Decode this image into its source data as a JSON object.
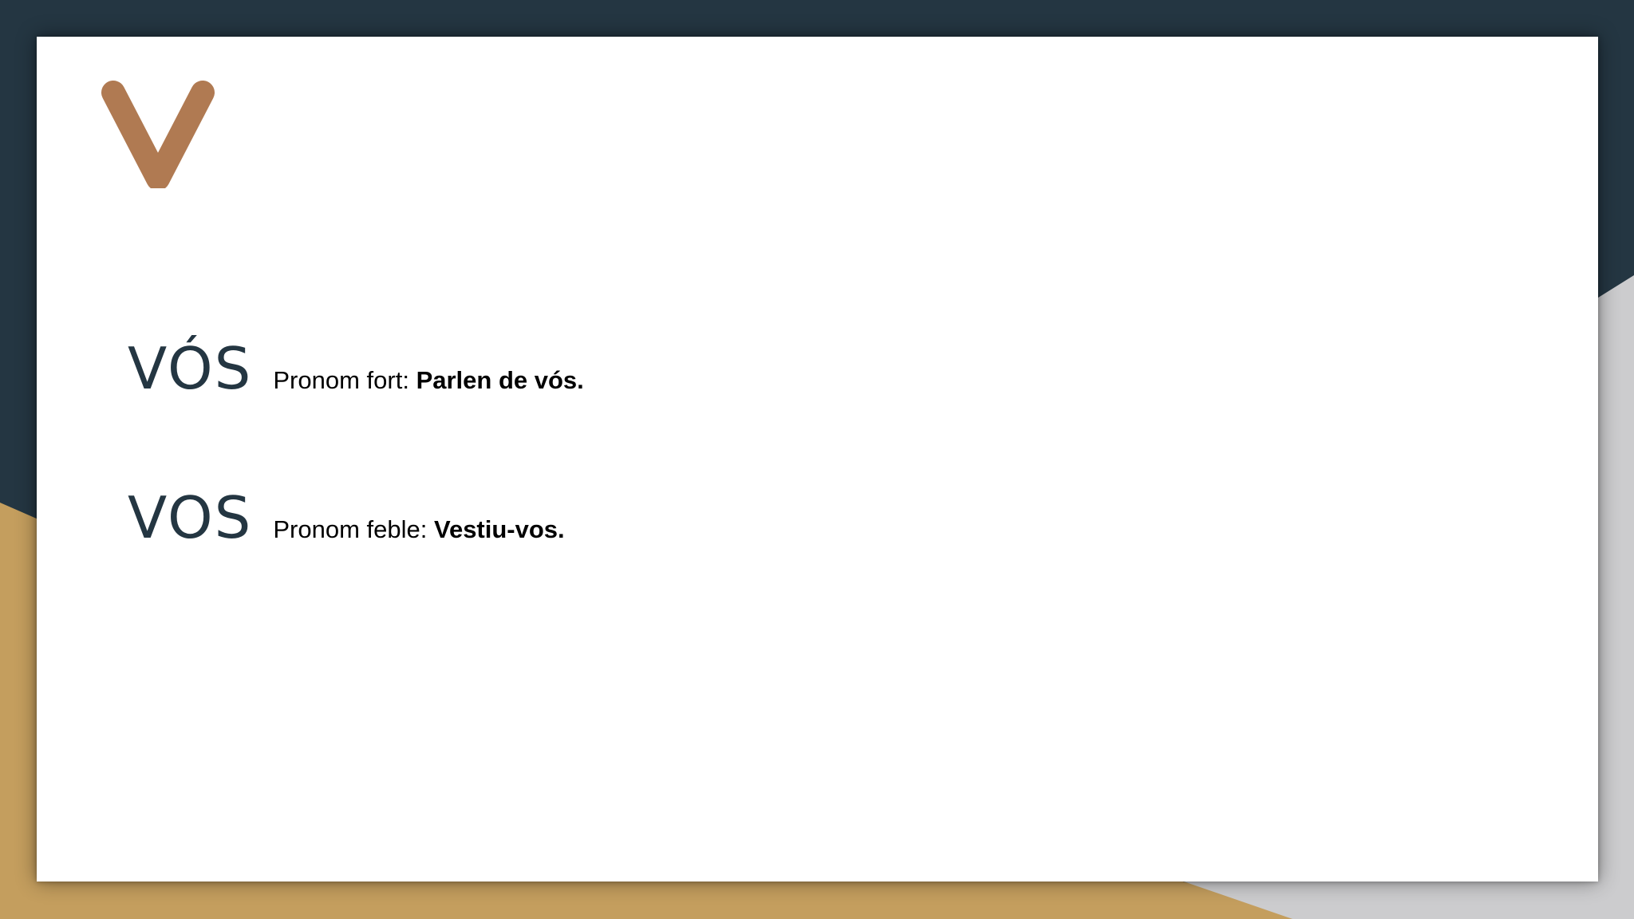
{
  "slide": {
    "logo_letter": "V",
    "entries": [
      {
        "word": "VÓS",
        "label": "Pronom fort: ",
        "example": "Parlen de vós."
      },
      {
        "word": "VOS",
        "label": "Pronom feble: ",
        "example": "Vestiu-vos."
      }
    ]
  },
  "colors": {
    "background_dark": "#243642",
    "accent_gold": "#C49E5E",
    "accent_gray": "#CCCCCE",
    "logo_brown": "#B07A52",
    "title_text": "#243642",
    "card": "#FFFFFF"
  }
}
